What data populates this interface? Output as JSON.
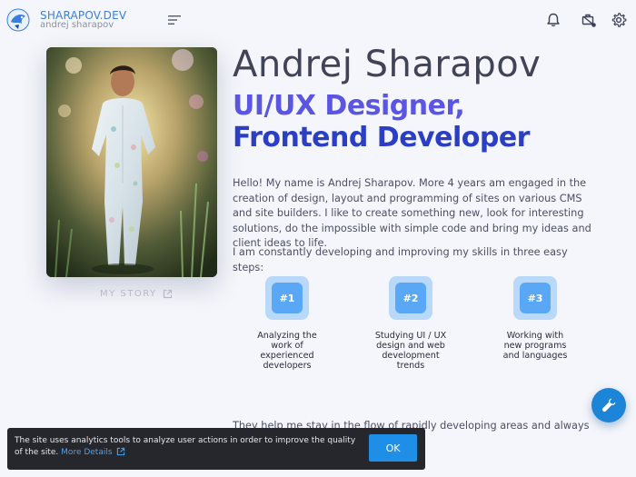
{
  "header": {
    "brand": "SHARAPOV.DEV",
    "brand_sub": "andrej sharapov",
    "icons": [
      "menu-icon",
      "bell-icon",
      "briefcase-badge-icon",
      "gear-icon"
    ]
  },
  "profile": {
    "my_story": "MY STORY"
  },
  "hero": {
    "name": "Andrej Sharapov",
    "role_line1": "UI/UX Designer,",
    "role_line2": "Frontend Developer"
  },
  "about": {
    "p1": "Hello! My name is Andrej Sharapov. More 4 years am engaged in the creation of design, layout and programming of sites on various CMS and site builders. I like to create something new, look for interesting solutions, do the impossible with simple code and bring my ideas and client ideas to life.",
    "p2": "I am constantly developing and improving my skills in three easy steps:",
    "p3": "They help me stay in the flow of rapidly developing areas and always keep abreast of the latest trends."
  },
  "steps": [
    {
      "badge": "#1",
      "label": "Analyzing the work of experienced developers"
    },
    {
      "badge": "#2",
      "label": "Studying UI / UX design and web development trends"
    },
    {
      "badge": "#3",
      "label": "Working with new programs and languages"
    }
  ],
  "cookie": {
    "text": "The site uses analytics tools to analyze user actions in order to improve the quality of the site.",
    "link": "More Details",
    "ok": "OK"
  },
  "colors": {
    "accent": "#1f8ee6",
    "role_gradient_start": "#5a55e3",
    "role_gradient_end": "#2a3fc4",
    "badge": "#5aa8f5"
  }
}
